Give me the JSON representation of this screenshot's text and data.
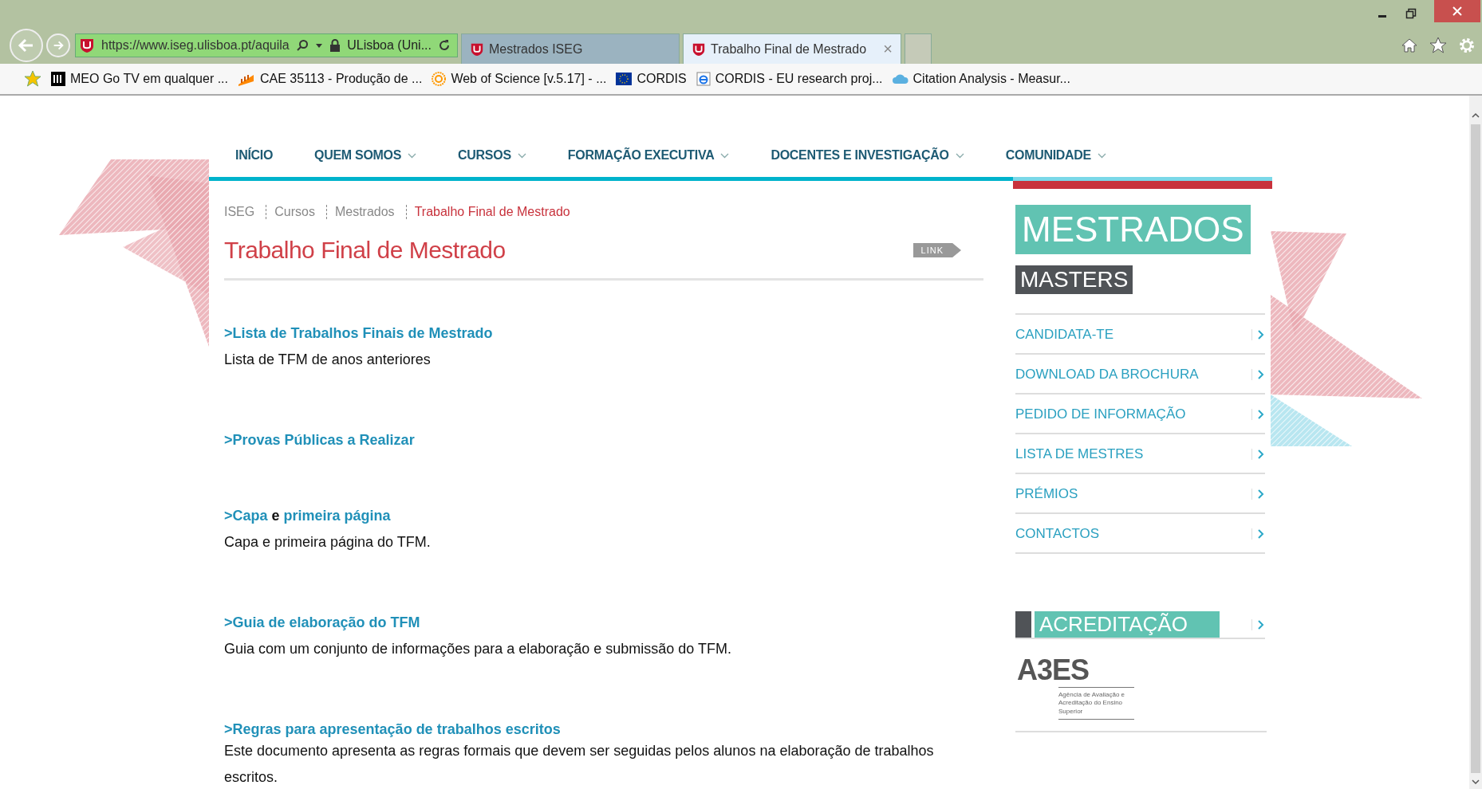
{
  "browser": {
    "address": {
      "url": "https://www.iseg.ulisboa.pt/aquila",
      "site_identity": "ULisboa (Uni..."
    },
    "tabs": [
      {
        "label": "Mestrados ISEG",
        "selected": false,
        "closable": false
      },
      {
        "label": "Trabalho Final de Mestrado",
        "selected": true,
        "closable": true
      }
    ],
    "close_glyph": "×",
    "bookmarks": [
      {
        "label": "MEO Go  TV em qualquer ..."
      },
      {
        "label": "CAE 35113 - Produção de ..."
      },
      {
        "label": "Web of Science [v.5.17] - ..."
      },
      {
        "label": "CORDIS"
      },
      {
        "label": "CORDIS - EU research proj..."
      },
      {
        "label": "Citation Analysis - Measur..."
      }
    ]
  },
  "nav": [
    {
      "label": "INÍCIO",
      "dropdown": false
    },
    {
      "label": "QUEM SOMOS",
      "dropdown": true
    },
    {
      "label": "CURSOS",
      "dropdown": true
    },
    {
      "label": "FORMAÇÃO EXECUTIVA",
      "dropdown": true
    },
    {
      "label": "DOCENTES E INVESTIGAÇÃO",
      "dropdown": true
    },
    {
      "label": "COMUNIDADE",
      "dropdown": true
    }
  ],
  "breadcrumb": [
    {
      "label": "ISEG",
      "current": false
    },
    {
      "label": "Cursos",
      "current": false
    },
    {
      "label": "Mestrados",
      "current": false
    },
    {
      "label": "Trabalho Final de Mestrado",
      "current": true
    }
  ],
  "page_title": "Trabalho Final de Mestrado",
  "link_badge": "LINK",
  "sections": [
    {
      "heading": [
        {
          "text": ">Lista de Trabalhos Finais de Mestrado",
          "kind": "link"
        }
      ],
      "description": "Lista de TFM de anos anteriores"
    },
    {
      "heading": [
        {
          "text": ">Provas Públicas a Realizar",
          "kind": "link"
        }
      ]
    },
    {
      "heading": [
        {
          "text": ">Capa",
          "kind": "link"
        },
        {
          "text": "e",
          "kind": "plain"
        },
        {
          "text": "primeira página",
          "kind": "link"
        }
      ],
      "description": "Capa e primeira página do TFM."
    },
    {
      "heading": [
        {
          "text": ">Guia de elaboração do TFM",
          "kind": "link"
        }
      ],
      "description": "Guia com um conjunto de informações para a elaboração e submissão do TFM."
    },
    {
      "heading": [
        {
          "text": ">Regras para apresentação de trabalhos escritos",
          "kind": "link"
        }
      ],
      "description": "Este documento apresenta as regras formais que devem ser seguidas pelos alunos na elaboração de trabalhos escritos."
    }
  ],
  "sidebar": {
    "title": "MESTRADOS",
    "subtitle": "MASTERS",
    "menu": [
      "CANDIDATA-TE",
      "DOWNLOAD DA BROCHURA",
      "PEDIDO DE INFORMAÇÃO",
      "LISTA DE MESTRES",
      "PRÉMIOS",
      "CONTACTOS"
    ],
    "accreditation": {
      "title": "ACREDITAÇÃO",
      "logo": "A3ES",
      "logo_caption": "Agência de Avaliação e Acreditação do Ensino Superior"
    }
  }
}
